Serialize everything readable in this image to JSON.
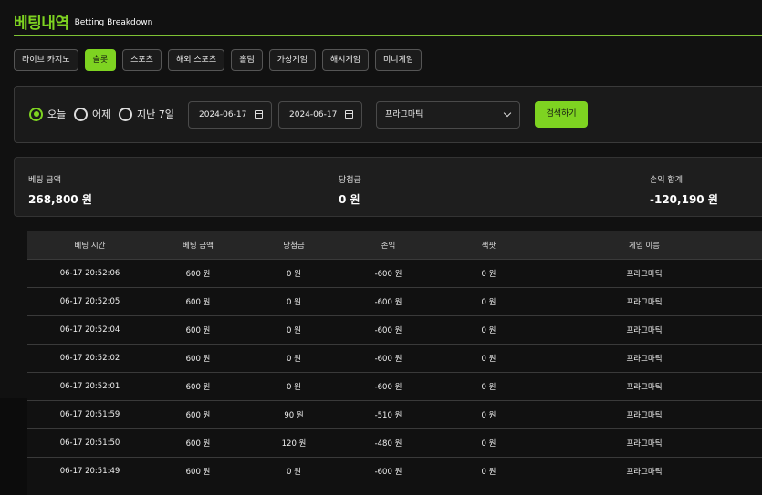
{
  "header": {
    "title": "베팅내역",
    "subtitle": "Betting Breakdown"
  },
  "tabs": [
    {
      "label": "라이브 카지노",
      "active": false
    },
    {
      "label": "슬롯",
      "active": true
    },
    {
      "label": "스포츠",
      "active": false
    },
    {
      "label": "해외 스포츠",
      "active": false
    },
    {
      "label": "홀덤",
      "active": false
    },
    {
      "label": "가상게임",
      "active": false
    },
    {
      "label": "해시게임",
      "active": false
    },
    {
      "label": "미니게임",
      "active": false
    }
  ],
  "filter": {
    "radios": [
      {
        "label": "오늘",
        "checked": true
      },
      {
        "label": "어제",
        "checked": false
      },
      {
        "label": "지난 7일",
        "checked": false
      }
    ],
    "date_from": "2024-06-17",
    "date_to": "2024-06-17",
    "provider_selected": "프라그마틱",
    "search_label": "검색하기"
  },
  "summary": {
    "bet_amount_label": "베팅 금액",
    "bet_amount": "268,800 원",
    "win_label": "당첨금",
    "win": "0 원",
    "profit_label": "손익 합계",
    "profit": "-120,190 원"
  },
  "table": {
    "headers": [
      "베팅 시간",
      "베팅 금액",
      "당첨금",
      "손익",
      "잭팟",
      "게임 이름"
    ],
    "rows": [
      [
        "06-17 20:52:06",
        "600 원",
        "0 원",
        "-600 원",
        "0 원",
        "프라그마틱"
      ],
      [
        "06-17 20:52:05",
        "600 원",
        "0 원",
        "-600 원",
        "0 원",
        "프라그마틱"
      ],
      [
        "06-17 20:52:04",
        "600 원",
        "0 원",
        "-600 원",
        "0 원",
        "프라그마틱"
      ],
      [
        "06-17 20:52:02",
        "600 원",
        "0 원",
        "-600 원",
        "0 원",
        "프라그마틱"
      ],
      [
        "06-17 20:52:01",
        "600 원",
        "0 원",
        "-600 원",
        "0 원",
        "프라그마틱"
      ],
      [
        "06-17 20:51:59",
        "600 원",
        "90 원",
        "-510 원",
        "0 원",
        "프라그마틱"
      ],
      [
        "06-17 20:51:50",
        "600 원",
        "120 원",
        "-480 원",
        "0 원",
        "프라그마틱"
      ],
      [
        "06-17 20:51:49",
        "600 원",
        "0 원",
        "-600 원",
        "0 원",
        "프라그마틱"
      ]
    ]
  },
  "colors": {
    "accent": "#7ed321",
    "background": "#111111",
    "panel": "#1a1a1a"
  }
}
